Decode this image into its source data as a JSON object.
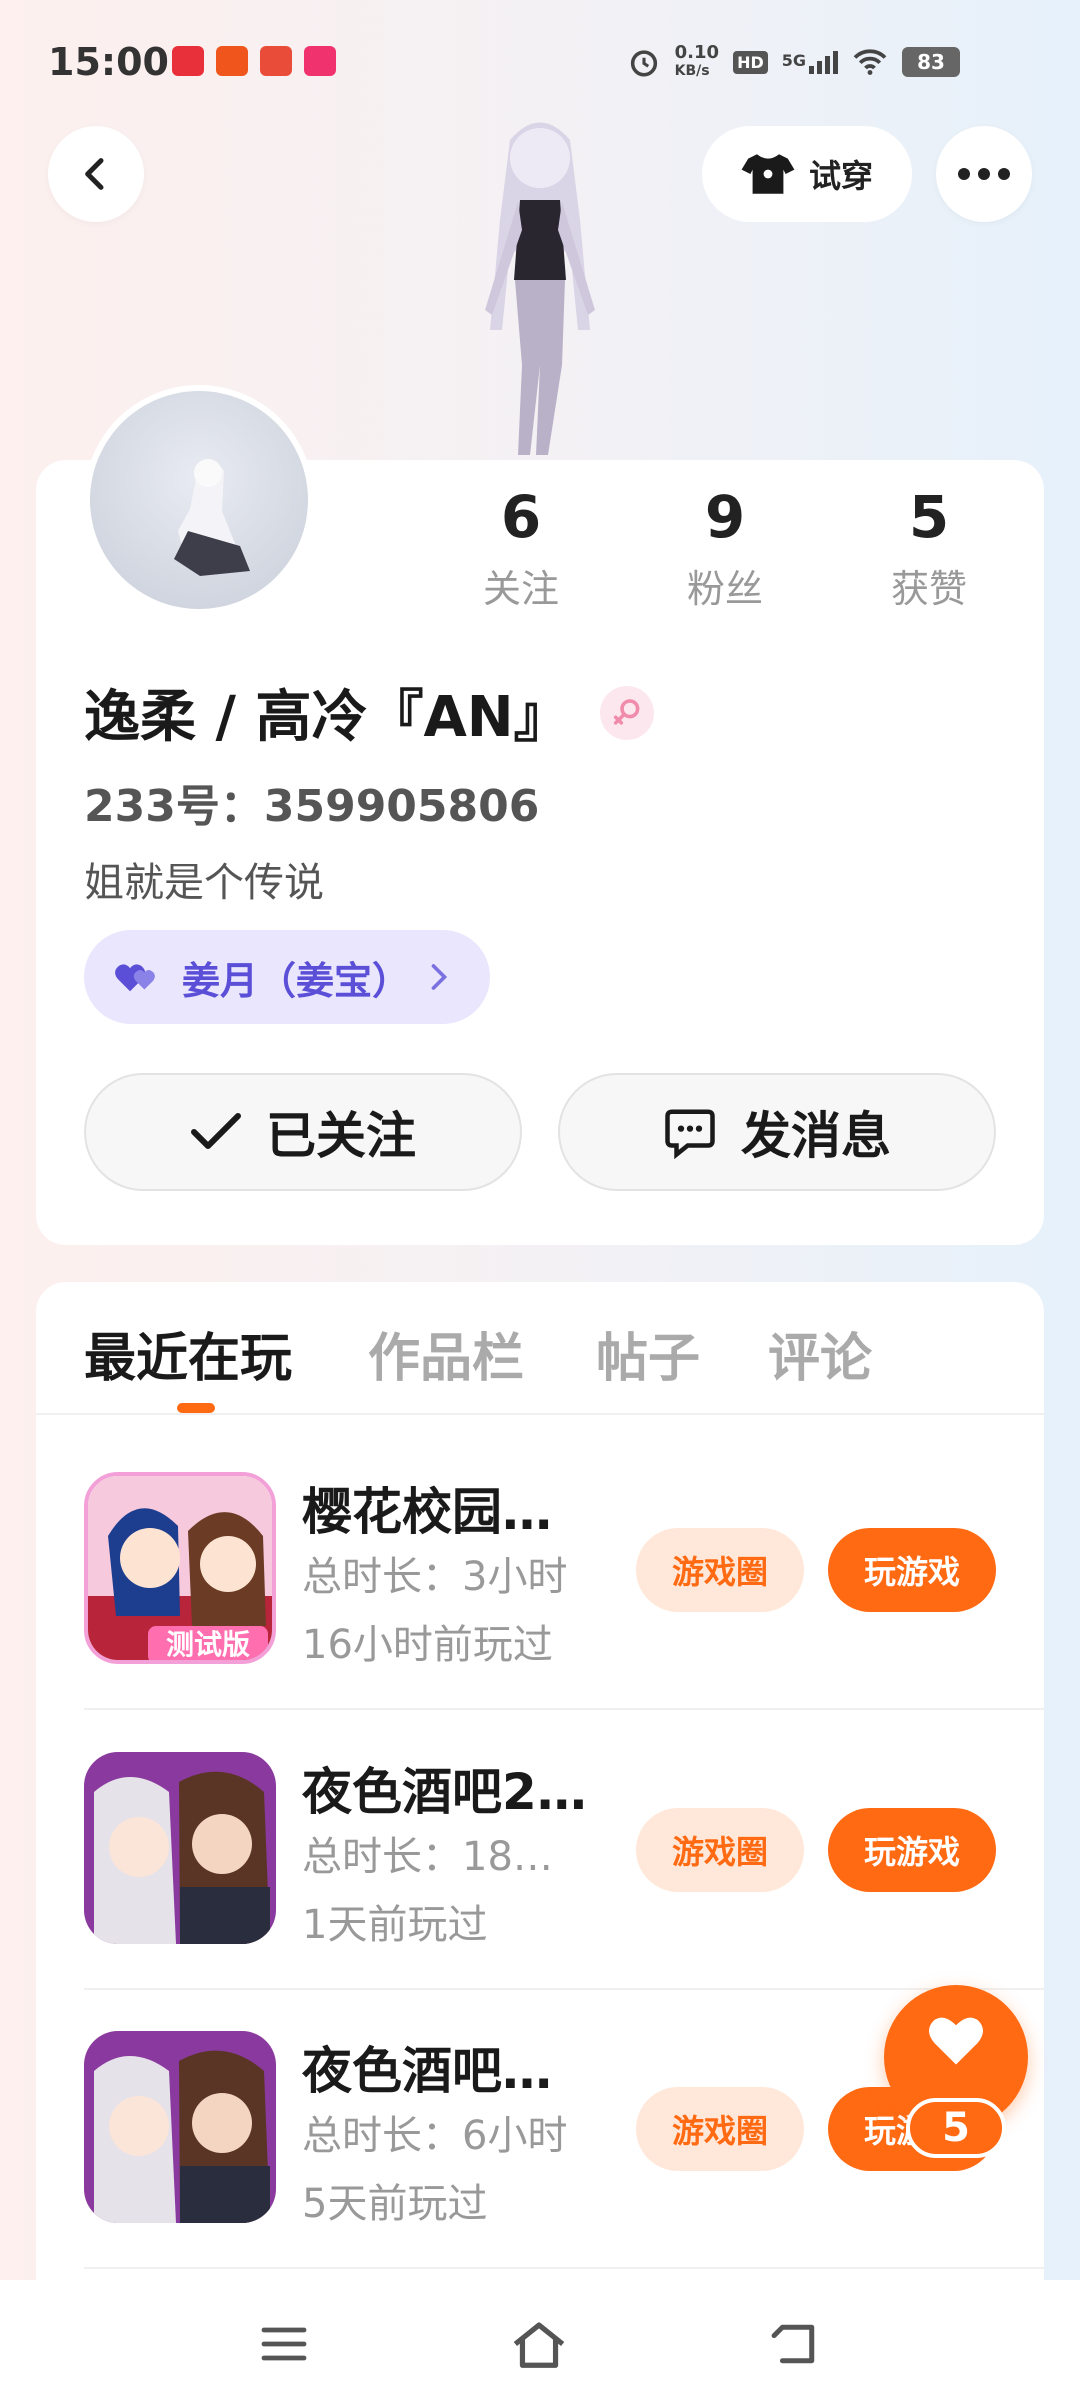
{
  "status": {
    "time": "15:00",
    "net_speed": "0.10",
    "net_unit": "KB/s",
    "hd": "HD",
    "signal": "5G",
    "battery": "83"
  },
  "header": {
    "tryon_label": "试穿"
  },
  "profile": {
    "name": "逸柔 / 高冷『AN』",
    "uid": "233号：359905806",
    "bio": "姐就是个传说",
    "cp_label": "姜月（姜宝）",
    "stats": [
      {
        "num": "6",
        "label": "关注"
      },
      {
        "num": "9",
        "label": "粉丝"
      },
      {
        "num": "5",
        "label": "获赞"
      }
    ],
    "follow_label": "已关注",
    "message_label": "发消息"
  },
  "tabs": [
    "最近在玩",
    "作品栏",
    "帖子",
    "评论"
  ],
  "games": [
    {
      "title": "樱花校园…",
      "duration": "总时长：3小时",
      "last_played": "16小时前玩过",
      "circle_label": "游戏圈",
      "play_label": "玩游戏",
      "badge": "测试版"
    },
    {
      "title": "夜色酒吧2…",
      "duration": "总时长：18…",
      "last_played": "1天前玩过",
      "circle_label": "游戏圈",
      "play_label": "玩游戏"
    },
    {
      "title": "夜色酒吧…",
      "duration": "总时长：6小时",
      "last_played": "5天前玩过",
      "circle_label": "游戏圈",
      "play_label": "玩游戏"
    }
  ],
  "fab": {
    "count": "5"
  },
  "colors": {
    "accent": "#ff6a13",
    "accent_light": "#ffe8da",
    "cp_bg": "#e9e6fd",
    "cp_text": "#5b4fd8"
  }
}
